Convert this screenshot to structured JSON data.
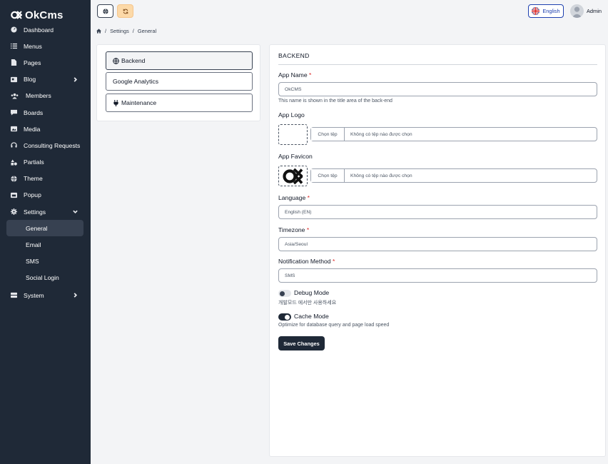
{
  "brand": {
    "name": "OkCms"
  },
  "sidebar": {
    "items": [
      {
        "label": "Dashboard",
        "icon": "dashboard-icon"
      },
      {
        "label": "Menus",
        "icon": "list-icon"
      },
      {
        "label": "Pages",
        "icon": "pages-icon"
      },
      {
        "label": "Blog",
        "icon": "blog-icon",
        "has_children": true
      },
      {
        "label": "Members",
        "icon": "users-icon"
      },
      {
        "label": "Boards",
        "icon": "comment-icon"
      },
      {
        "label": "Media",
        "icon": "image-icon"
      },
      {
        "label": "Consulting Requests",
        "icon": "headset-icon"
      },
      {
        "label": "Partials",
        "icon": "shapes-icon"
      },
      {
        "label": "Theme",
        "icon": "globe-icon"
      },
      {
        "label": "Popup",
        "icon": "popup-icon"
      },
      {
        "label": "Settings",
        "icon": "gear-icon",
        "expanded": true
      },
      {
        "label": "System",
        "icon": "server-icon",
        "has_children": true
      }
    ],
    "settings_children": [
      "General",
      "Email",
      "SMS",
      "Social Login"
    ],
    "active_child": "General"
  },
  "header": {
    "language_button": "English",
    "user_name": "Admin"
  },
  "breadcrumb": {
    "items": [
      "Settings",
      "General"
    ]
  },
  "tabs": [
    {
      "label": "Backend",
      "icon": "globe-icon",
      "active": true
    },
    {
      "label": "Google Analytics",
      "icon": "",
      "active": false
    },
    {
      "label": "Maintenance",
      "icon": "plug-icon",
      "active": false
    }
  ],
  "form": {
    "section_title": "BACKEND",
    "app_name": {
      "label": "App Name",
      "required": "*",
      "value": "OkCMS",
      "help": "This name is shown in the title area of the back-end"
    },
    "app_logo": {
      "label": "App Logo",
      "file_button": "Chọn tệp",
      "file_text": "Không có tệp nào được chọn"
    },
    "app_favicon": {
      "label": "App Favicon",
      "file_button": "Chọn tệp",
      "file_text": "Không có tệp nào được chọn"
    },
    "language": {
      "label": "Language",
      "required": "*",
      "value": "English (EN)"
    },
    "timezone": {
      "label": "Timezone",
      "required": "*",
      "value": "Asia/Seoul"
    },
    "notification": {
      "label": "Notification Method",
      "required": "*",
      "value": "SMS"
    },
    "debug_mode": {
      "label": "Debug Mode",
      "help": "개발모드 에서만 사용하세요",
      "enabled": false
    },
    "cache_mode": {
      "label": "Cache Mode",
      "help": "Optimize for database query and page load speed",
      "enabled": true
    },
    "save_label": "Save Changes"
  },
  "colors": {
    "sidebar_bg": "#1f2937",
    "accent": "#1e40af",
    "refresh_btn": "#fcd9a8",
    "required": "#dc2626"
  }
}
